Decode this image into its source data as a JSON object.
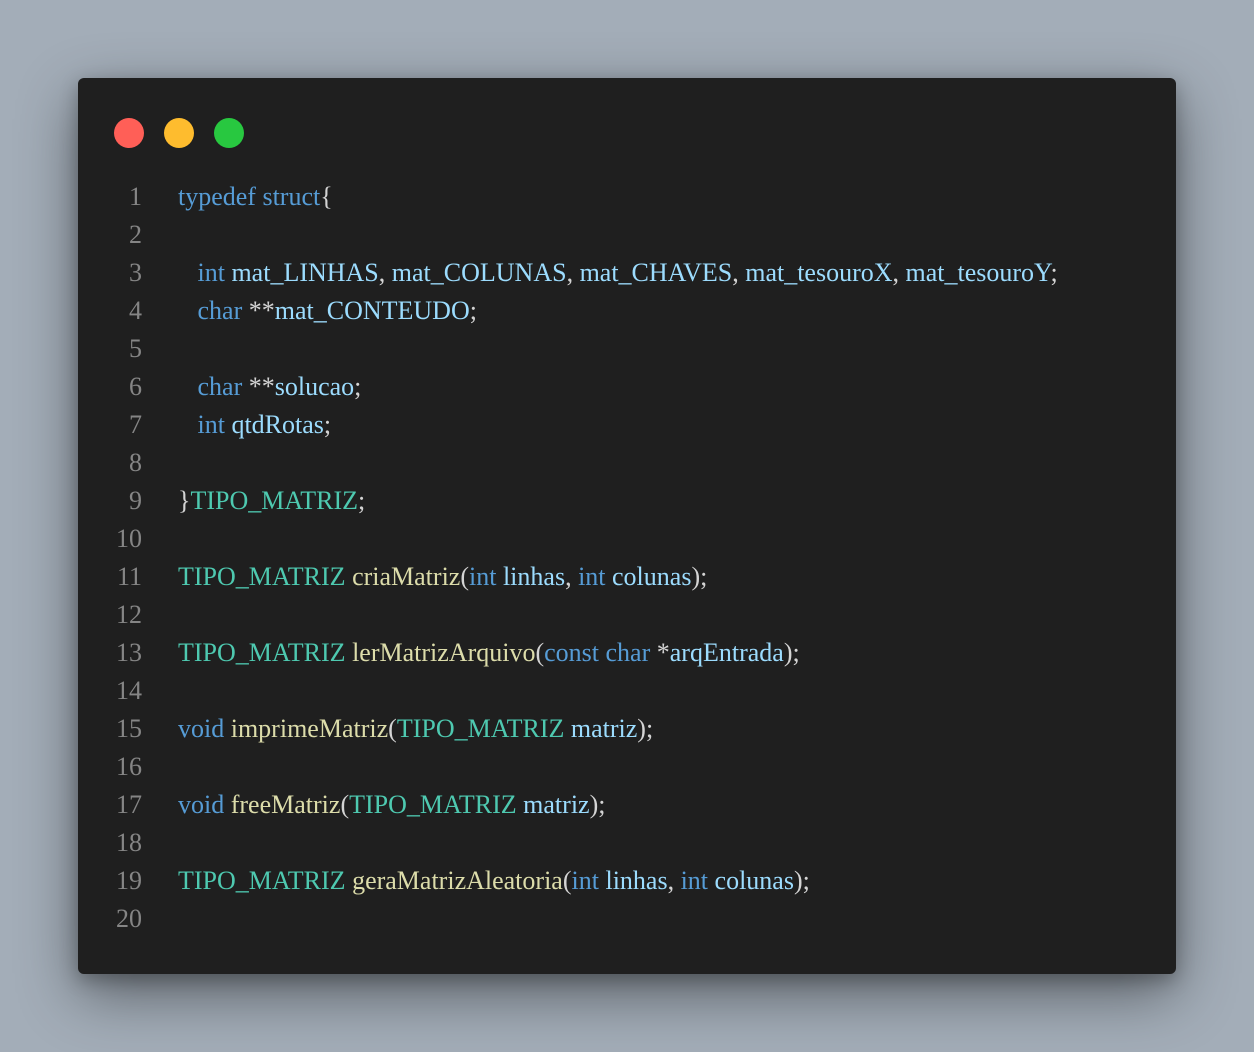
{
  "colors": {
    "background": "#a3adb8",
    "window": "#1f1f1f",
    "close": "#ff5f57",
    "minimize": "#febc2e",
    "maximize": "#28c840",
    "line_number": "#858585",
    "keyword": "#569cd6",
    "variable": "#9cdcfe",
    "type": "#4ec9b0",
    "function": "#dcdcaa",
    "punctuation": "#d4d4d4"
  },
  "window_controls": {
    "close": "close-button",
    "minimize": "minimize-button",
    "maximize": "maximize-button"
  },
  "code_lines": [
    {
      "number": "1",
      "tokens": [
        {
          "text": "typedef",
          "kind": "keyword"
        },
        {
          "text": " ",
          "kind": "punctuation"
        },
        {
          "text": "struct",
          "kind": "keyword"
        },
        {
          "text": "{",
          "kind": "punctuation"
        }
      ]
    },
    {
      "number": "2",
      "tokens": []
    },
    {
      "number": "3",
      "tokens": [
        {
          "text": "   ",
          "kind": "punctuation"
        },
        {
          "text": "int",
          "kind": "keyword"
        },
        {
          "text": " ",
          "kind": "punctuation"
        },
        {
          "text": "mat_LINHAS",
          "kind": "variable"
        },
        {
          "text": ", ",
          "kind": "punctuation"
        },
        {
          "text": "mat_COLUNAS",
          "kind": "variable"
        },
        {
          "text": ", ",
          "kind": "punctuation"
        },
        {
          "text": "mat_CHAVES",
          "kind": "variable"
        },
        {
          "text": ", ",
          "kind": "punctuation"
        },
        {
          "text": "mat_tesouroX",
          "kind": "variable"
        },
        {
          "text": ", ",
          "kind": "punctuation"
        },
        {
          "text": "mat_tesouroY",
          "kind": "variable"
        },
        {
          "text": ";",
          "kind": "punctuation"
        }
      ]
    },
    {
      "number": "4",
      "tokens": [
        {
          "text": "   ",
          "kind": "punctuation"
        },
        {
          "text": "char",
          "kind": "keyword"
        },
        {
          "text": " **",
          "kind": "punctuation"
        },
        {
          "text": "mat_CONTEUDO",
          "kind": "variable"
        },
        {
          "text": ";",
          "kind": "punctuation"
        }
      ]
    },
    {
      "number": "5",
      "tokens": []
    },
    {
      "number": "6",
      "tokens": [
        {
          "text": "   ",
          "kind": "punctuation"
        },
        {
          "text": "char",
          "kind": "keyword"
        },
        {
          "text": " **",
          "kind": "punctuation"
        },
        {
          "text": "solucao",
          "kind": "variable"
        },
        {
          "text": ";",
          "kind": "punctuation"
        }
      ]
    },
    {
      "number": "7",
      "tokens": [
        {
          "text": "   ",
          "kind": "punctuation"
        },
        {
          "text": "int",
          "kind": "keyword"
        },
        {
          "text": " ",
          "kind": "punctuation"
        },
        {
          "text": "qtdRotas",
          "kind": "variable"
        },
        {
          "text": ";",
          "kind": "punctuation"
        }
      ]
    },
    {
      "number": "8",
      "tokens": []
    },
    {
      "number": "9",
      "tokens": [
        {
          "text": "}",
          "kind": "punctuation"
        },
        {
          "text": "TIPO_MATRIZ",
          "kind": "type"
        },
        {
          "text": ";",
          "kind": "punctuation"
        }
      ]
    },
    {
      "number": "10",
      "tokens": []
    },
    {
      "number": "11",
      "tokens": [
        {
          "text": "TIPO_MATRIZ",
          "kind": "type"
        },
        {
          "text": " ",
          "kind": "punctuation"
        },
        {
          "text": "criaMatriz",
          "kind": "function"
        },
        {
          "text": "(",
          "kind": "punctuation"
        },
        {
          "text": "int",
          "kind": "keyword"
        },
        {
          "text": " ",
          "kind": "punctuation"
        },
        {
          "text": "linhas",
          "kind": "variable"
        },
        {
          "text": ", ",
          "kind": "punctuation"
        },
        {
          "text": "int",
          "kind": "keyword"
        },
        {
          "text": " ",
          "kind": "punctuation"
        },
        {
          "text": "colunas",
          "kind": "variable"
        },
        {
          "text": ");",
          "kind": "punctuation"
        }
      ]
    },
    {
      "number": "12",
      "tokens": []
    },
    {
      "number": "13",
      "tokens": [
        {
          "text": "TIPO_MATRIZ",
          "kind": "type"
        },
        {
          "text": " ",
          "kind": "punctuation"
        },
        {
          "text": "lerMatrizArquivo",
          "kind": "function"
        },
        {
          "text": "(",
          "kind": "punctuation"
        },
        {
          "text": "const",
          "kind": "keyword"
        },
        {
          "text": " ",
          "kind": "punctuation"
        },
        {
          "text": "char",
          "kind": "keyword"
        },
        {
          "text": " *",
          "kind": "punctuation"
        },
        {
          "text": "arqEntrada",
          "kind": "variable"
        },
        {
          "text": ");",
          "kind": "punctuation"
        }
      ]
    },
    {
      "number": "14",
      "tokens": []
    },
    {
      "number": "15",
      "tokens": [
        {
          "text": "void",
          "kind": "keyword"
        },
        {
          "text": " ",
          "kind": "punctuation"
        },
        {
          "text": "imprimeMatriz",
          "kind": "function"
        },
        {
          "text": "(",
          "kind": "punctuation"
        },
        {
          "text": "TIPO_MATRIZ",
          "kind": "type"
        },
        {
          "text": " ",
          "kind": "punctuation"
        },
        {
          "text": "matriz",
          "kind": "variable"
        },
        {
          "text": ");",
          "kind": "punctuation"
        }
      ]
    },
    {
      "number": "16",
      "tokens": []
    },
    {
      "number": "17",
      "tokens": [
        {
          "text": "void",
          "kind": "keyword"
        },
        {
          "text": " ",
          "kind": "punctuation"
        },
        {
          "text": "freeMatriz",
          "kind": "function"
        },
        {
          "text": "(",
          "kind": "punctuation"
        },
        {
          "text": "TIPO_MATRIZ",
          "kind": "type"
        },
        {
          "text": " ",
          "kind": "punctuation"
        },
        {
          "text": "matriz",
          "kind": "variable"
        },
        {
          "text": ");",
          "kind": "punctuation"
        }
      ]
    },
    {
      "number": "18",
      "tokens": []
    },
    {
      "number": "19",
      "tokens": [
        {
          "text": "TIPO_MATRIZ",
          "kind": "type"
        },
        {
          "text": " ",
          "kind": "punctuation"
        },
        {
          "text": "geraMatrizAleatoria",
          "kind": "function"
        },
        {
          "text": "(",
          "kind": "punctuation"
        },
        {
          "text": "int",
          "kind": "keyword"
        },
        {
          "text": " ",
          "kind": "punctuation"
        },
        {
          "text": "linhas",
          "kind": "variable"
        },
        {
          "text": ", ",
          "kind": "punctuation"
        },
        {
          "text": "int",
          "kind": "keyword"
        },
        {
          "text": " ",
          "kind": "punctuation"
        },
        {
          "text": "colunas",
          "kind": "variable"
        },
        {
          "text": ");",
          "kind": "punctuation"
        }
      ]
    },
    {
      "number": "20",
      "tokens": []
    }
  ]
}
